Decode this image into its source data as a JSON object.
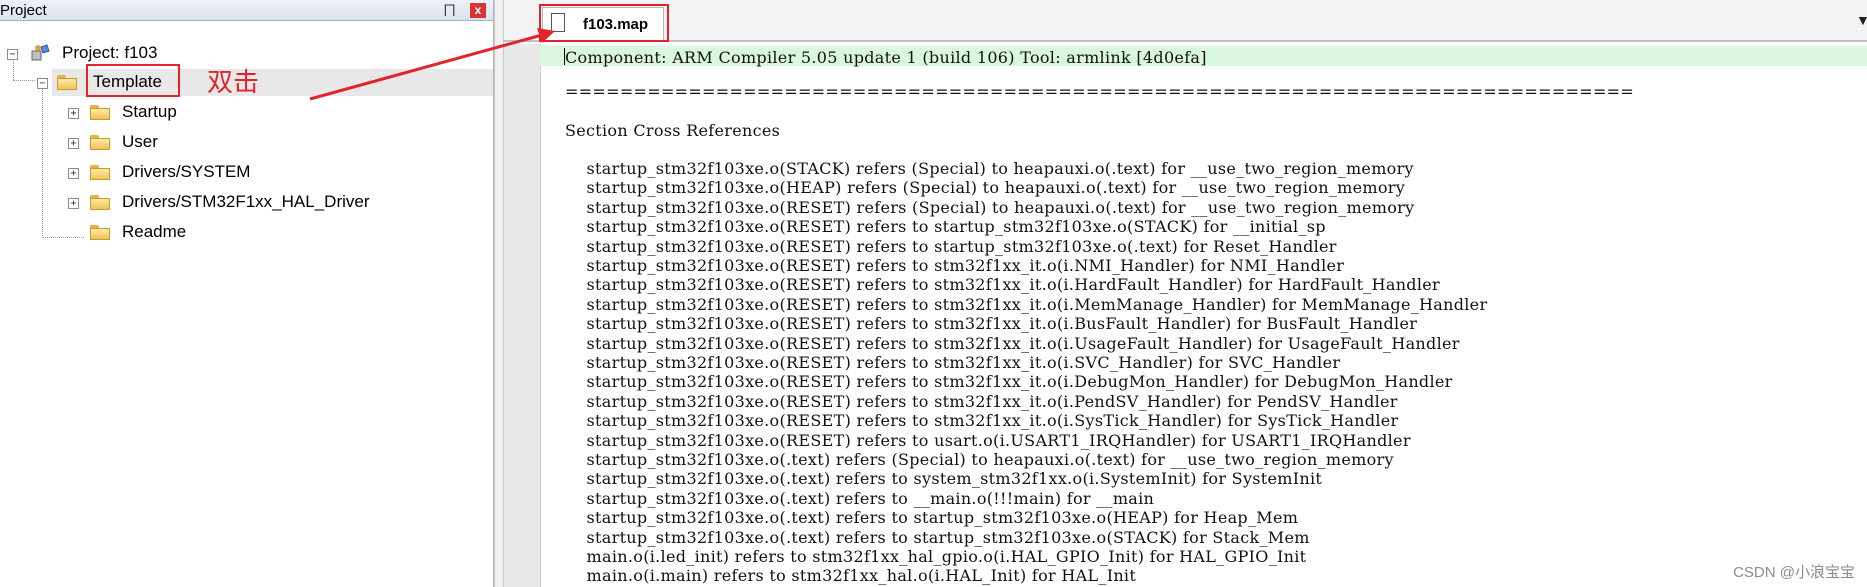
{
  "project_panel": {
    "title": "Project",
    "close_label": "x",
    "pin_label": "⨅",
    "root_label": "Project: f103",
    "target_label": "Template",
    "groups": [
      {
        "label": "Startup"
      },
      {
        "label": "User"
      },
      {
        "label": "Drivers/SYSTEM"
      },
      {
        "label": "Drivers/STM32F1xx_HAL_Driver"
      },
      {
        "label": "Readme"
      }
    ]
  },
  "annotation": {
    "text": "双击",
    "color": "#e3232b"
  },
  "editor": {
    "tab_label": "f103.map",
    "dropdown": "▼",
    "lines": [
      "Component: ARM Compiler 5.05 update 1 (build 106) Tool: armlink [4d0efa]",
      "",
      "==============================================================================",
      "",
      "Section Cross References",
      "",
      "    startup_stm32f103xe.o(STACK) refers (Special) to heapauxi.o(.text) for __use_two_region_memory",
      "    startup_stm32f103xe.o(HEAP) refers (Special) to heapauxi.o(.text) for __use_two_region_memory",
      "    startup_stm32f103xe.o(RESET) refers (Special) to heapauxi.o(.text) for __use_two_region_memory",
      "    startup_stm32f103xe.o(RESET) refers to startup_stm32f103xe.o(STACK) for __initial_sp",
      "    startup_stm32f103xe.o(RESET) refers to startup_stm32f103xe.o(.text) for Reset_Handler",
      "    startup_stm32f103xe.o(RESET) refers to stm32f1xx_it.o(i.NMI_Handler) for NMI_Handler",
      "    startup_stm32f103xe.o(RESET) refers to stm32f1xx_it.o(i.HardFault_Handler) for HardFault_Handler",
      "    startup_stm32f103xe.o(RESET) refers to stm32f1xx_it.o(i.MemManage_Handler) for MemManage_Handler",
      "    startup_stm32f103xe.o(RESET) refers to stm32f1xx_it.o(i.BusFault_Handler) for BusFault_Handler",
      "    startup_stm32f103xe.o(RESET) refers to stm32f1xx_it.o(i.UsageFault_Handler) for UsageFault_Handler",
      "    startup_stm32f103xe.o(RESET) refers to stm32f1xx_it.o(i.SVC_Handler) for SVC_Handler",
      "    startup_stm32f103xe.o(RESET) refers to stm32f1xx_it.o(i.DebugMon_Handler) for DebugMon_Handler",
      "    startup_stm32f103xe.o(RESET) refers to stm32f1xx_it.o(i.PendSV_Handler) for PendSV_Handler",
      "    startup_stm32f103xe.o(RESET) refers to stm32f1xx_it.o(i.SysTick_Handler) for SysTick_Handler",
      "    startup_stm32f103xe.o(RESET) refers to usart.o(i.USART1_IRQHandler) for USART1_IRQHandler",
      "    startup_stm32f103xe.o(.text) refers (Special) to heapauxi.o(.text) for __use_two_region_memory",
      "    startup_stm32f103xe.o(.text) refers to system_stm32f1xx.o(i.SystemInit) for SystemInit",
      "    startup_stm32f103xe.o(.text) refers to __main.o(!!!main) for __main",
      "    startup_stm32f103xe.o(.text) refers to startup_stm32f103xe.o(HEAP) for Heap_Mem",
      "    startup_stm32f103xe.o(.text) refers to startup_stm32f103xe.o(STACK) for Stack_Mem",
      "    main.o(i.led_init) refers to stm32f1xx_hal_gpio.o(i.HAL_GPIO_Init) for HAL_GPIO_Init",
      "    main.o(i.main) refers to stm32f1xx_hal.o(i.HAL_Init) for HAL_Init"
    ]
  },
  "watermark": "CSDN @小浪宝宝",
  "colors": {
    "highlight": "#d9f7dc",
    "annotation_red": "#e3232b"
  }
}
